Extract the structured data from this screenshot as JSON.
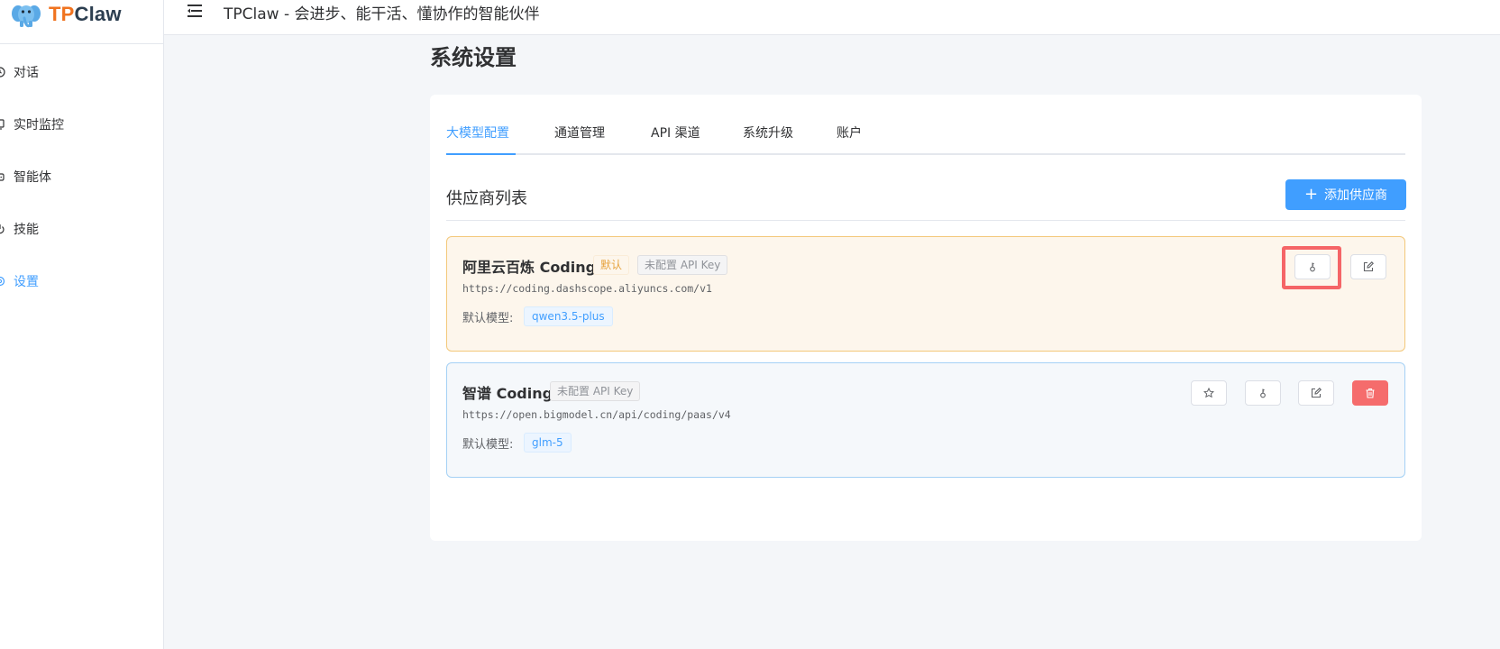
{
  "app": {
    "logo_tp": "TP",
    "logo_claw": "Claw",
    "header_title": "TPClaw - 会进步、能干活、懂协作的智能伙伴"
  },
  "sidebar": {
    "items": [
      {
        "label": "对话",
        "icon": "clock-icon",
        "active": false
      },
      {
        "label": "实时监控",
        "icon": "monitor-icon",
        "active": false
      },
      {
        "label": "智能体",
        "icon": "robot-icon",
        "active": false
      },
      {
        "label": "技能",
        "icon": "power-icon",
        "active": false
      },
      {
        "label": "设置",
        "icon": "gear-icon",
        "active": true
      }
    ]
  },
  "page": {
    "title": "系统设置"
  },
  "tabs": [
    {
      "label": "大模型配置",
      "active": true
    },
    {
      "label": "通道管理",
      "active": false
    },
    {
      "label": "API 渠道",
      "active": false
    },
    {
      "label": "系统升级",
      "active": false
    },
    {
      "label": "账户",
      "active": false
    }
  ],
  "section": {
    "title": "供应商列表",
    "add_button": "添加供应商"
  },
  "providers": [
    {
      "name": "阿里云百炼 Coding",
      "default_badge": "默认",
      "api_badge": "未配置 API Key",
      "url": "https://coding.dashscope.aliyuncs.com/v1",
      "model_label": "默认模型:",
      "model": "qwen3.5-plus"
    },
    {
      "name": "智谱 Coding",
      "api_badge": "未配置 API Key",
      "url": "https://open.bigmodel.cn/api/coding/paas/v4",
      "model_label": "默认模型:",
      "model": "glm-5"
    }
  ],
  "colors": {
    "primary": "#409eff",
    "warning": "#e6a23c",
    "danger": "#f56c6c",
    "highlight": "#f56567",
    "logo_orange": "#f0731f"
  }
}
